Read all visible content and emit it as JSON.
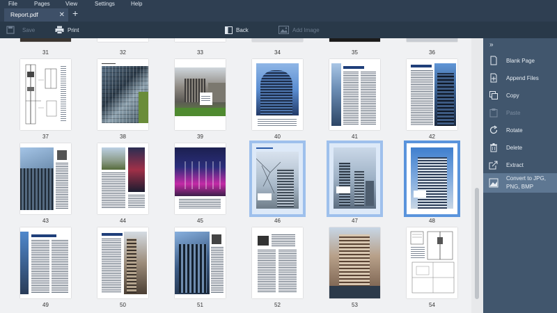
{
  "menu": [
    "File",
    "Pages",
    "View",
    "Settings",
    "Help"
  ],
  "tab": {
    "title": "Report.pdf",
    "close": "✕",
    "add": "+"
  },
  "toolbar": {
    "save": "Save",
    "print": "Print",
    "back": "Back",
    "add_image": "Add Image"
  },
  "pages": {
    "top_row": [
      "31",
      "32",
      "33",
      "34",
      "35",
      "36"
    ],
    "rows": [
      [
        "37",
        "38",
        "39",
        "40",
        "41",
        "42"
      ],
      [
        "43",
        "44",
        "45",
        "46",
        "47",
        "48"
      ],
      [
        "49",
        "50",
        "51",
        "52",
        "53",
        "54"
      ]
    ],
    "selected": [
      "46",
      "47"
    ],
    "current": "48"
  },
  "panel": {
    "collapse": "»",
    "items": [
      {
        "label": "Blank Page",
        "icon": "blank-page-icon",
        "state": "normal"
      },
      {
        "label": "Append Files",
        "icon": "append-files-icon",
        "state": "normal"
      },
      {
        "label": "Copy",
        "icon": "copy-icon",
        "state": "normal"
      },
      {
        "label": "Paste",
        "icon": "paste-icon",
        "state": "disabled"
      },
      {
        "label": "Rotate",
        "icon": "rotate-icon",
        "state": "normal"
      },
      {
        "label": "Delete",
        "icon": "trash-icon",
        "state": "normal"
      },
      {
        "label": "Extract",
        "icon": "extract-icon",
        "state": "normal"
      },
      {
        "label": "Convert to JPG,",
        "label2": "PNG, BMP",
        "icon": "convert-image-icon",
        "state": "active"
      }
    ]
  },
  "colors": {
    "chrome": "#2f3f52",
    "panel": "#41566d",
    "selection": "#9ec0ec",
    "current": "#5a94dc"
  }
}
